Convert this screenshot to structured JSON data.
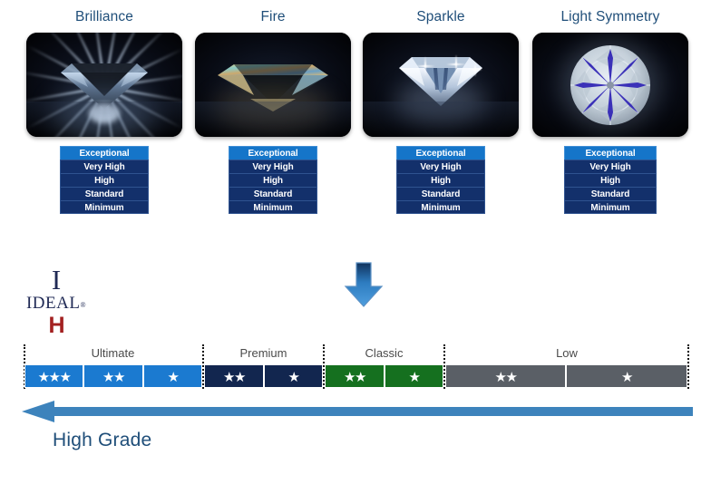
{
  "attributes": [
    {
      "title": "Brilliance",
      "image_name": "diamond-brilliance-photo",
      "ratings": [
        "Exceptional",
        "Very High",
        "High",
        "Standard",
        "Minimum"
      ]
    },
    {
      "title": "Fire",
      "image_name": "diamond-fire-photo",
      "ratings": [
        "Exceptional",
        "Very High",
        "High",
        "Standard",
        "Minimum"
      ]
    },
    {
      "title": "Sparkle",
      "image_name": "diamond-sparkle-photo",
      "ratings": [
        "Exceptional",
        "Very High",
        "High",
        "Standard",
        "Minimum"
      ]
    },
    {
      "title": "Light Symmetry",
      "image_name": "diamond-light-symmetry-photo",
      "ratings": [
        "Exceptional",
        "Very High",
        "High",
        "Standard",
        "Minimum"
      ]
    }
  ],
  "logo": {
    "mark": "I",
    "word": "IDEAL",
    "registered": "®",
    "sub_mark": "H"
  },
  "arrow_down": {
    "name": "down-arrow-icon",
    "color": "#2f7fc4"
  },
  "scale": {
    "groups": [
      {
        "label": "Ultimate",
        "color": "#1b7ad0"
      },
      {
        "label": "Premium",
        "color": "#12264f"
      },
      {
        "label": "Classic",
        "color": "#15701f"
      },
      {
        "label": "Low",
        "color": "#5a5f66"
      }
    ],
    "segments": [
      {
        "group": "Ultimate",
        "stars": "★★★",
        "star_count": 3,
        "color": "#1b7ad0"
      },
      {
        "group": "Ultimate",
        "stars": "★★",
        "star_count": 2,
        "color": "#1b7ad0"
      },
      {
        "group": "Ultimate",
        "stars": "★",
        "star_count": 1,
        "color": "#1b7ad0"
      },
      {
        "group": "Premium",
        "stars": "★★",
        "star_count": 2,
        "color": "#12264f"
      },
      {
        "group": "Premium",
        "stars": "★",
        "star_count": 1,
        "color": "#12264f"
      },
      {
        "group": "Classic",
        "stars": "★★",
        "star_count": 2,
        "color": "#15701f"
      },
      {
        "group": "Classic",
        "stars": "★",
        "star_count": 1,
        "color": "#15701f"
      },
      {
        "group": "Low",
        "stars": "★★",
        "star_count": 2,
        "color": "#5a5f66"
      },
      {
        "group": "Low",
        "stars": "★",
        "star_count": 1,
        "color": "#5a5f66"
      }
    ]
  },
  "direction": {
    "caption": "High Grade",
    "arrow_name": "left-arrow-icon",
    "arrow_color": "#2f7fc4",
    "caption_color": "#1f4e79"
  },
  "colors": {
    "title_text": "#1f4e79",
    "rating_top": "#1575c9",
    "rating_rest": "#13306b",
    "group_label": "#4a4a4a"
  }
}
